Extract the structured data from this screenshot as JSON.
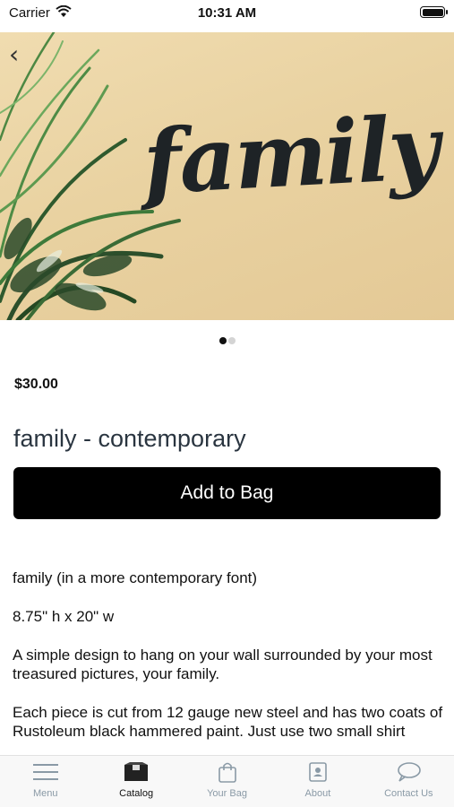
{
  "status": {
    "carrier": "Carrier",
    "time": "10:31 AM"
  },
  "hero": {
    "word": "family"
  },
  "carousel": {
    "count": 2,
    "active_index": 0
  },
  "product": {
    "price": "$30.00",
    "title": "family - contemporary",
    "add_button": "Add to Bag",
    "description": [
      "family (in a more contemporary font)",
      "8.75\" h x 20\" w",
      "A simple design to hang on your wall surrounded by your most treasured pictures, your family.",
      "Each piece is cut from 12 gauge new steel and has two coats of Rustoleum black hammered paint. Just use two small shirt"
    ]
  },
  "tabs": [
    {
      "label": "Menu",
      "icon": "menu-icon"
    },
    {
      "label": "Catalog",
      "icon": "catalog-icon",
      "active": true
    },
    {
      "label": "Your Bag",
      "icon": "bag-icon"
    },
    {
      "label": "About",
      "icon": "about-icon"
    },
    {
      "label": "Contact Us",
      "icon": "chat-icon"
    }
  ]
}
